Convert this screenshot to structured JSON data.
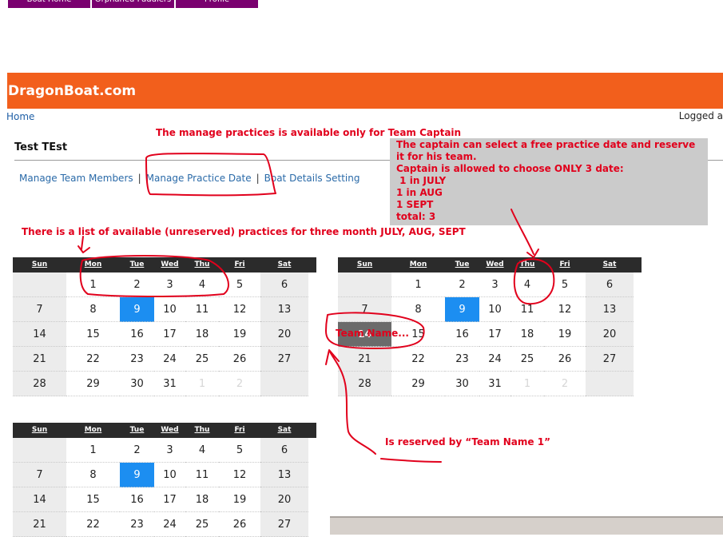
{
  "top_tabs": [
    "Boat Home",
    "Orphaned Paddlers",
    "Profile"
  ],
  "header": {
    "site_title": "DragonBoat.com",
    "home_link": "Home",
    "logged": "Logged a"
  },
  "team": {
    "name": "Test TEst"
  },
  "nav": {
    "items": [
      "Manage Team Members",
      "Manage Practice Date",
      "Boat Details Setting"
    ],
    "separator": "|"
  },
  "annotations": {
    "captain_only": "The manage practices is available only for Team Captain",
    "box_lines": [
      "The captain can select a free practice date and reserve",
      "it for his team.",
      "Captain is allowed to choose ONLY 3 date:",
      " 1 in JULY",
      "1 in AUG",
      "1 SEPT",
      "total: 3"
    ],
    "list_note": "There is a list of available (unreserved) practices for three month JULY, AUG, SEPT",
    "reserved_note": "Is reserved by “Team Name 1”",
    "team_name_label": "Team Name..."
  },
  "weekday_labels": [
    "Sun",
    "Mon",
    "Tue",
    "Wed",
    "Thu",
    "Fri",
    "Sat"
  ],
  "calendars": [
    {
      "weeks": [
        [
          "",
          "1",
          "2",
          "3",
          "4",
          "5",
          "6"
        ],
        [
          "7",
          "8",
          "9",
          "10",
          "11",
          "12",
          "13"
        ],
        [
          "14",
          "15",
          "16",
          "17",
          "18",
          "19",
          "20"
        ],
        [
          "21",
          "22",
          "23",
          "24",
          "25",
          "26",
          "27"
        ],
        [
          "28",
          "29",
          "30",
          "31",
          "1",
          "2",
          ""
        ]
      ],
      "today": "9",
      "reserved": ""
    },
    {
      "weeks": [
        [
          "",
          "1",
          "2",
          "3",
          "4",
          "5",
          "6"
        ],
        [
          "7",
          "8",
          "9",
          "10",
          "11",
          "12",
          "13"
        ],
        [
          "14",
          "15",
          "16",
          "17",
          "18",
          "19",
          "20"
        ],
        [
          "21",
          "22",
          "23",
          "24",
          "25",
          "26",
          "27"
        ],
        [
          "28",
          "29",
          "30",
          "31",
          "1",
          "2",
          ""
        ]
      ],
      "today": "9",
      "reserved": "14"
    },
    {
      "weeks": [
        [
          "",
          "1",
          "2",
          "3",
          "4",
          "5",
          "6"
        ],
        [
          "7",
          "8",
          "9",
          "10",
          "11",
          "12",
          "13"
        ],
        [
          "14",
          "15",
          "16",
          "17",
          "18",
          "19",
          "20"
        ],
        [
          "21",
          "22",
          "23",
          "24",
          "25",
          "26",
          "27"
        ]
      ],
      "today": "9",
      "reserved": ""
    }
  ],
  "colors": {
    "header": "#f25f1c",
    "tab": "#7a006f",
    "today": "#1c8ef1",
    "reserved": "#6b6b6b",
    "annotation": "#e1001c"
  }
}
